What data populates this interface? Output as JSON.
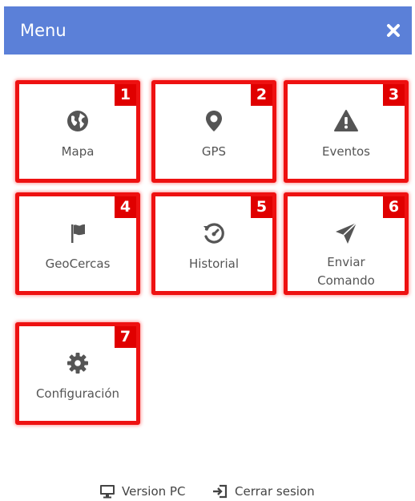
{
  "header": {
    "title": "Menu",
    "close_icon": "close-icon",
    "background": "#5b80d8"
  },
  "tiles": [
    {
      "badge": "1",
      "label": "Mapa",
      "icon": "globe-icon"
    },
    {
      "badge": "2",
      "label": "GPS",
      "icon": "map-marker-icon"
    },
    {
      "badge": "3",
      "label": "Eventos",
      "icon": "warning-icon"
    },
    {
      "badge": "4",
      "label": "GeoCercas",
      "icon": "flag-icon"
    },
    {
      "badge": "5",
      "label": "Historial",
      "icon": "history-icon"
    },
    {
      "badge": "6",
      "label": "Enviar\nComando",
      "icon": "paper-plane-icon"
    },
    {
      "badge": "7",
      "label": "Configuración",
      "icon": "gear-icon"
    }
  ],
  "footer": {
    "version_pc": {
      "label": "Version PC",
      "icon": "desktop-icon"
    },
    "logout": {
      "label": "Cerrar sesion",
      "icon": "sign-out-icon"
    }
  },
  "colors": {
    "highlight": "#ee1111",
    "badge": "#e00000",
    "icon": "#555555"
  }
}
